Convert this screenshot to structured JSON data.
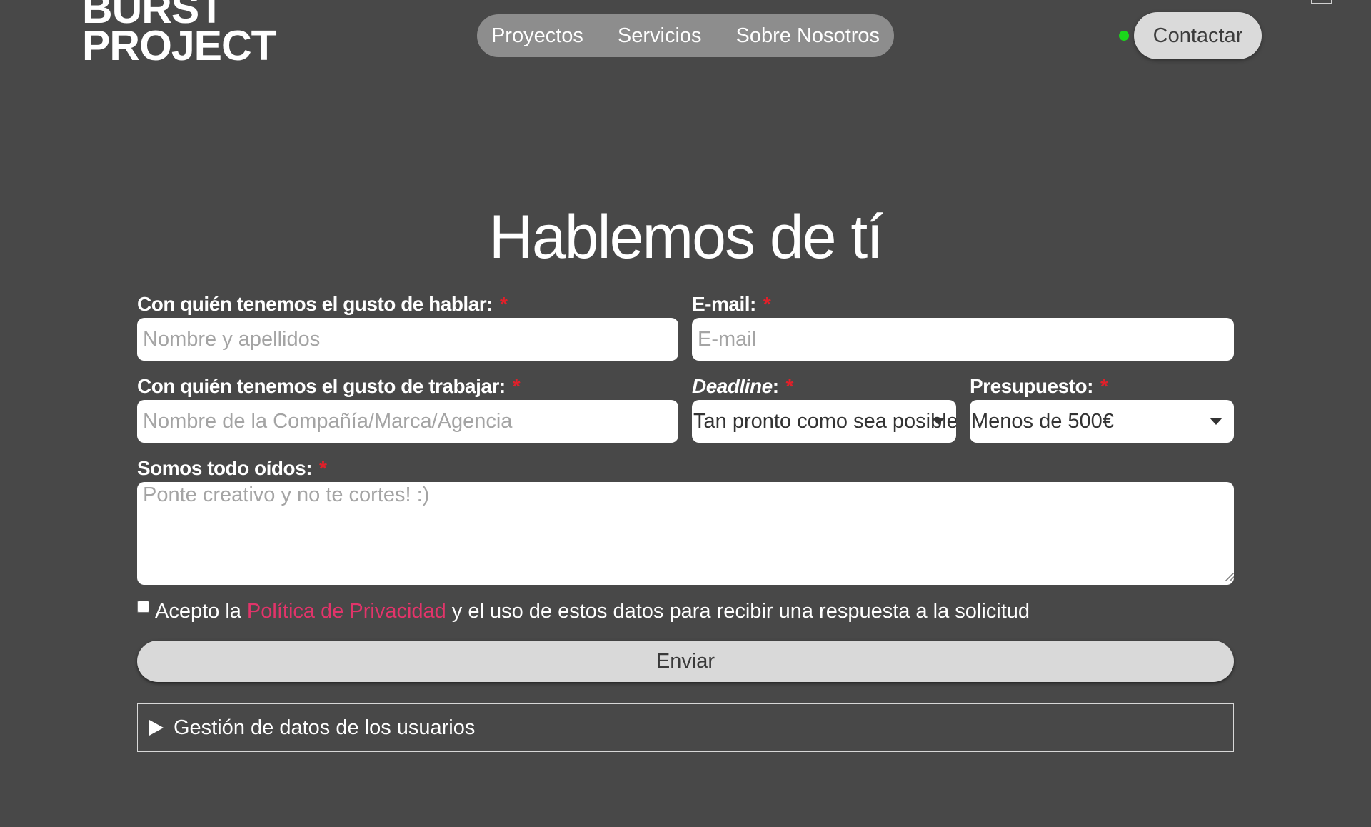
{
  "header": {
    "logo_line1": "BURST",
    "logo_line2": "PROJECT",
    "nav": [
      "Proyectos",
      "Servicios",
      "Sobre Nosotros"
    ],
    "contact_label": "Contactar",
    "status_color": "#1bd61b"
  },
  "main": {
    "title": "Hablemos de tí"
  },
  "form": {
    "required_mark": "*",
    "name": {
      "label": "Con quién tenemos el gusto de hablar:",
      "placeholder": "Nombre y apellidos",
      "value": ""
    },
    "email": {
      "label": "E-mail:",
      "placeholder": "E-mail",
      "value": ""
    },
    "company": {
      "label": "Con quién tenemos el gusto de trabajar:",
      "placeholder": "Nombre de la Compañía/Marca/Agencia",
      "value": ""
    },
    "deadline": {
      "label": "Deadline",
      "label_suffix": ":",
      "selected": "Tan pronto como sea posible"
    },
    "budget": {
      "label": "Presupuesto:",
      "selected": "Menos de 500€"
    },
    "message": {
      "label": "Somos todo oídos:",
      "placeholder": "Ponte creativo y no te cortes! :)",
      "value": ""
    },
    "consent": {
      "prefix": "Acepto la",
      "link": "Política de Privacidad",
      "suffix": "y el uso de estos datos para recibir una respuesta a la solicitud",
      "checked": false
    },
    "submit_label": "Enviar",
    "details_label": "Gestión de datos de los usuarios"
  },
  "colors": {
    "background": "#484848",
    "required": "#e0202a",
    "link": "#e2346a",
    "nav_pill": "#8d8d8d"
  }
}
